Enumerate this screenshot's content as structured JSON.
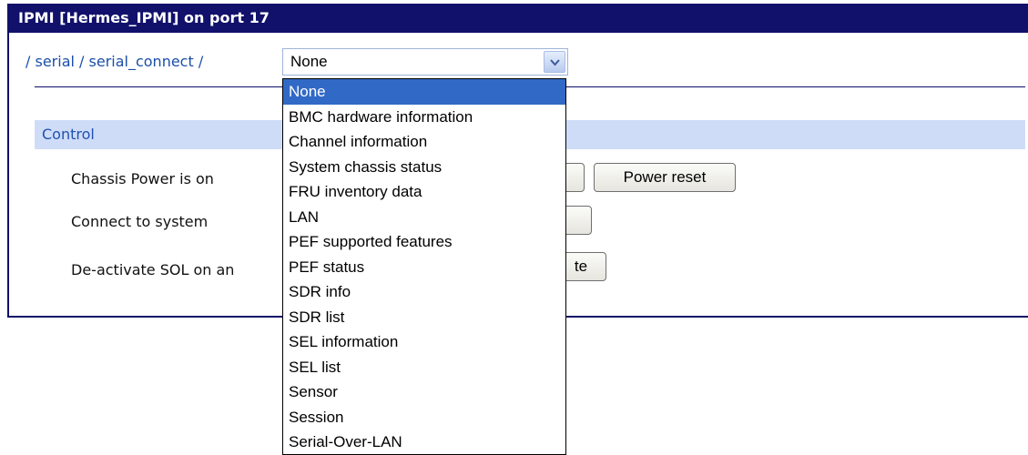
{
  "window": {
    "title": "IPMI [Hermes_IPMI] on port 17"
  },
  "breadcrumb": {
    "prefix_sep": "/",
    "items": [
      {
        "label": "serial"
      },
      {
        "label": "serial_connect"
      }
    ],
    "sep": "/"
  },
  "select": {
    "selected": "None",
    "options": [
      "None",
      "BMC hardware information",
      "Channel information",
      "System chassis status",
      "FRU inventory data",
      "LAN",
      "PEF supported features",
      "PEF status",
      "SDR info",
      "SDR list",
      "SEL information",
      "SEL list",
      "Sensor",
      "Session",
      "Serial-Over-LAN"
    ]
  },
  "control": {
    "header": "Control",
    "rows": [
      {
        "label": "Chassis Power is on"
      },
      {
        "label": "Connect to system"
      },
      {
        "label": "De-activate SOL on an"
      }
    ],
    "power_reset_label": "Power reset",
    "deactivate_partial_label": "te"
  }
}
